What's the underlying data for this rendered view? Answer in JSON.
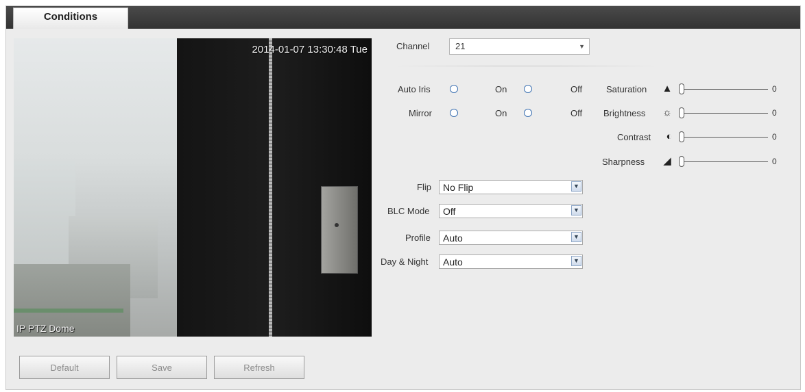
{
  "tab": {
    "label": "Conditions"
  },
  "video": {
    "timestamp": "2014-01-07 13:30:48 Tue",
    "camera_name": "IP PTZ Dome"
  },
  "channel": {
    "label": "Channel",
    "value": "21"
  },
  "auto_iris": {
    "label": "Auto Iris",
    "on_label": "On",
    "off_label": "Off"
  },
  "mirror": {
    "label": "Mirror",
    "on_label": "On",
    "off_label": "Off"
  },
  "sliders": [
    {
      "label": "Saturation",
      "value": "0",
      "icon": "saturation-icon"
    },
    {
      "label": "Brightness",
      "value": "0",
      "icon": "brightness-icon"
    },
    {
      "label": "Contrast",
      "value": "0",
      "icon": "contrast-icon"
    },
    {
      "label": "Sharpness",
      "value": "0",
      "icon": "sharpness-icon"
    }
  ],
  "flip": {
    "label": "Flip",
    "value": "No Flip"
  },
  "blc_mode": {
    "label": "BLC Mode",
    "value": "Off"
  },
  "profile": {
    "label": "Profile",
    "value": "Auto"
  },
  "day_night": {
    "label": "Day & Night",
    "value": "Auto"
  },
  "buttons": {
    "default": "Default",
    "save": "Save",
    "refresh": "Refresh"
  }
}
